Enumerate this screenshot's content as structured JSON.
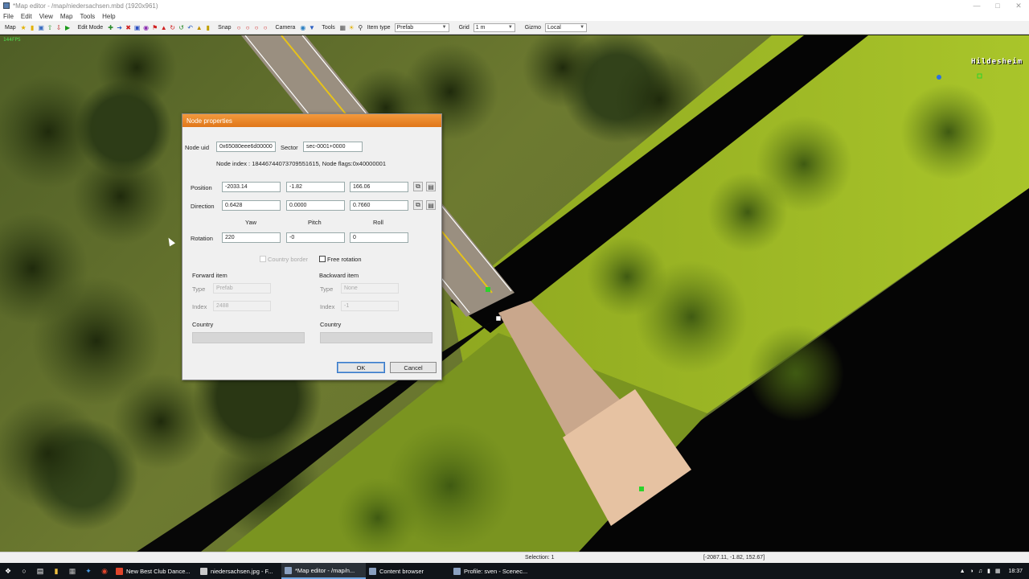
{
  "window": {
    "title": "*Map editor - /map/niedersachsen.mbd (1920x961)"
  },
  "menu": [
    "File",
    "Edit",
    "View",
    "Map",
    "Tools",
    "Help"
  ],
  "toolbar": {
    "map_label": "Map",
    "edit_mode_label": "Edit Mode",
    "snap_label": "Snap",
    "camera_label": "Camera",
    "tools_label": "Tools",
    "item_type_label": "Item type",
    "item_type_value": "Prefab",
    "grid_label": "Grid",
    "grid_value": "1 m",
    "gizmo_label": "Gizmo",
    "gizmo_value": "Local"
  },
  "viewport": {
    "fps": "144FPS",
    "city_label": "Hildesheim"
  },
  "dialog": {
    "title": "Node properties",
    "node_uid_label": "Node uid",
    "node_uid_value": "0x65080eee6d00000",
    "sector_label": "Sector",
    "sector_value": "sec-0001+0000",
    "info_line": "Node index : 18446744073709551615, Node flags:0x40000001",
    "position_label": "Position",
    "position": [
      "-2033.14",
      "-1.82",
      "166.06"
    ],
    "direction_label": "Direction",
    "direction": [
      "0.6428",
      "0.0000",
      "0.7660"
    ],
    "yaw_label": "Yaw",
    "pitch_label": "Pitch",
    "roll_label": "Roll",
    "rotation_label": "Rotation",
    "rotation": [
      "220",
      "-0",
      "0"
    ],
    "country_border_label": "Country border",
    "free_rotation_label": "Free rotation",
    "forward": {
      "heading": "Forward item",
      "type_label": "Type",
      "type_value": "Prefab",
      "index_label": "Index",
      "index_value": "2488",
      "country_label": "Country"
    },
    "backward": {
      "heading": "Backward item",
      "type_label": "Type",
      "type_value": "None",
      "index_label": "Index",
      "index_value": "-1",
      "country_label": "Country"
    },
    "ok_label": "OK",
    "cancel_label": "Cancel"
  },
  "status": {
    "selection": "Selection: 1",
    "coords": "[-2087.11, -1.82, 152.67]"
  },
  "taskbar": {
    "tasks": [
      {
        "label": "New Best Club Dance...",
        "color": "#e0452c"
      },
      {
        "label": "niedersachsen.jpg - F...",
        "color": "#c9c9c9"
      },
      {
        "label": "*Map editor - /map/n...",
        "color": "#8aa0c0"
      },
      {
        "label": "Content browser",
        "color": "#8aa0c0"
      },
      {
        "label": "Profile: sven - Scenec...",
        "color": "#8aa0c0"
      }
    ],
    "time": "18:37"
  }
}
